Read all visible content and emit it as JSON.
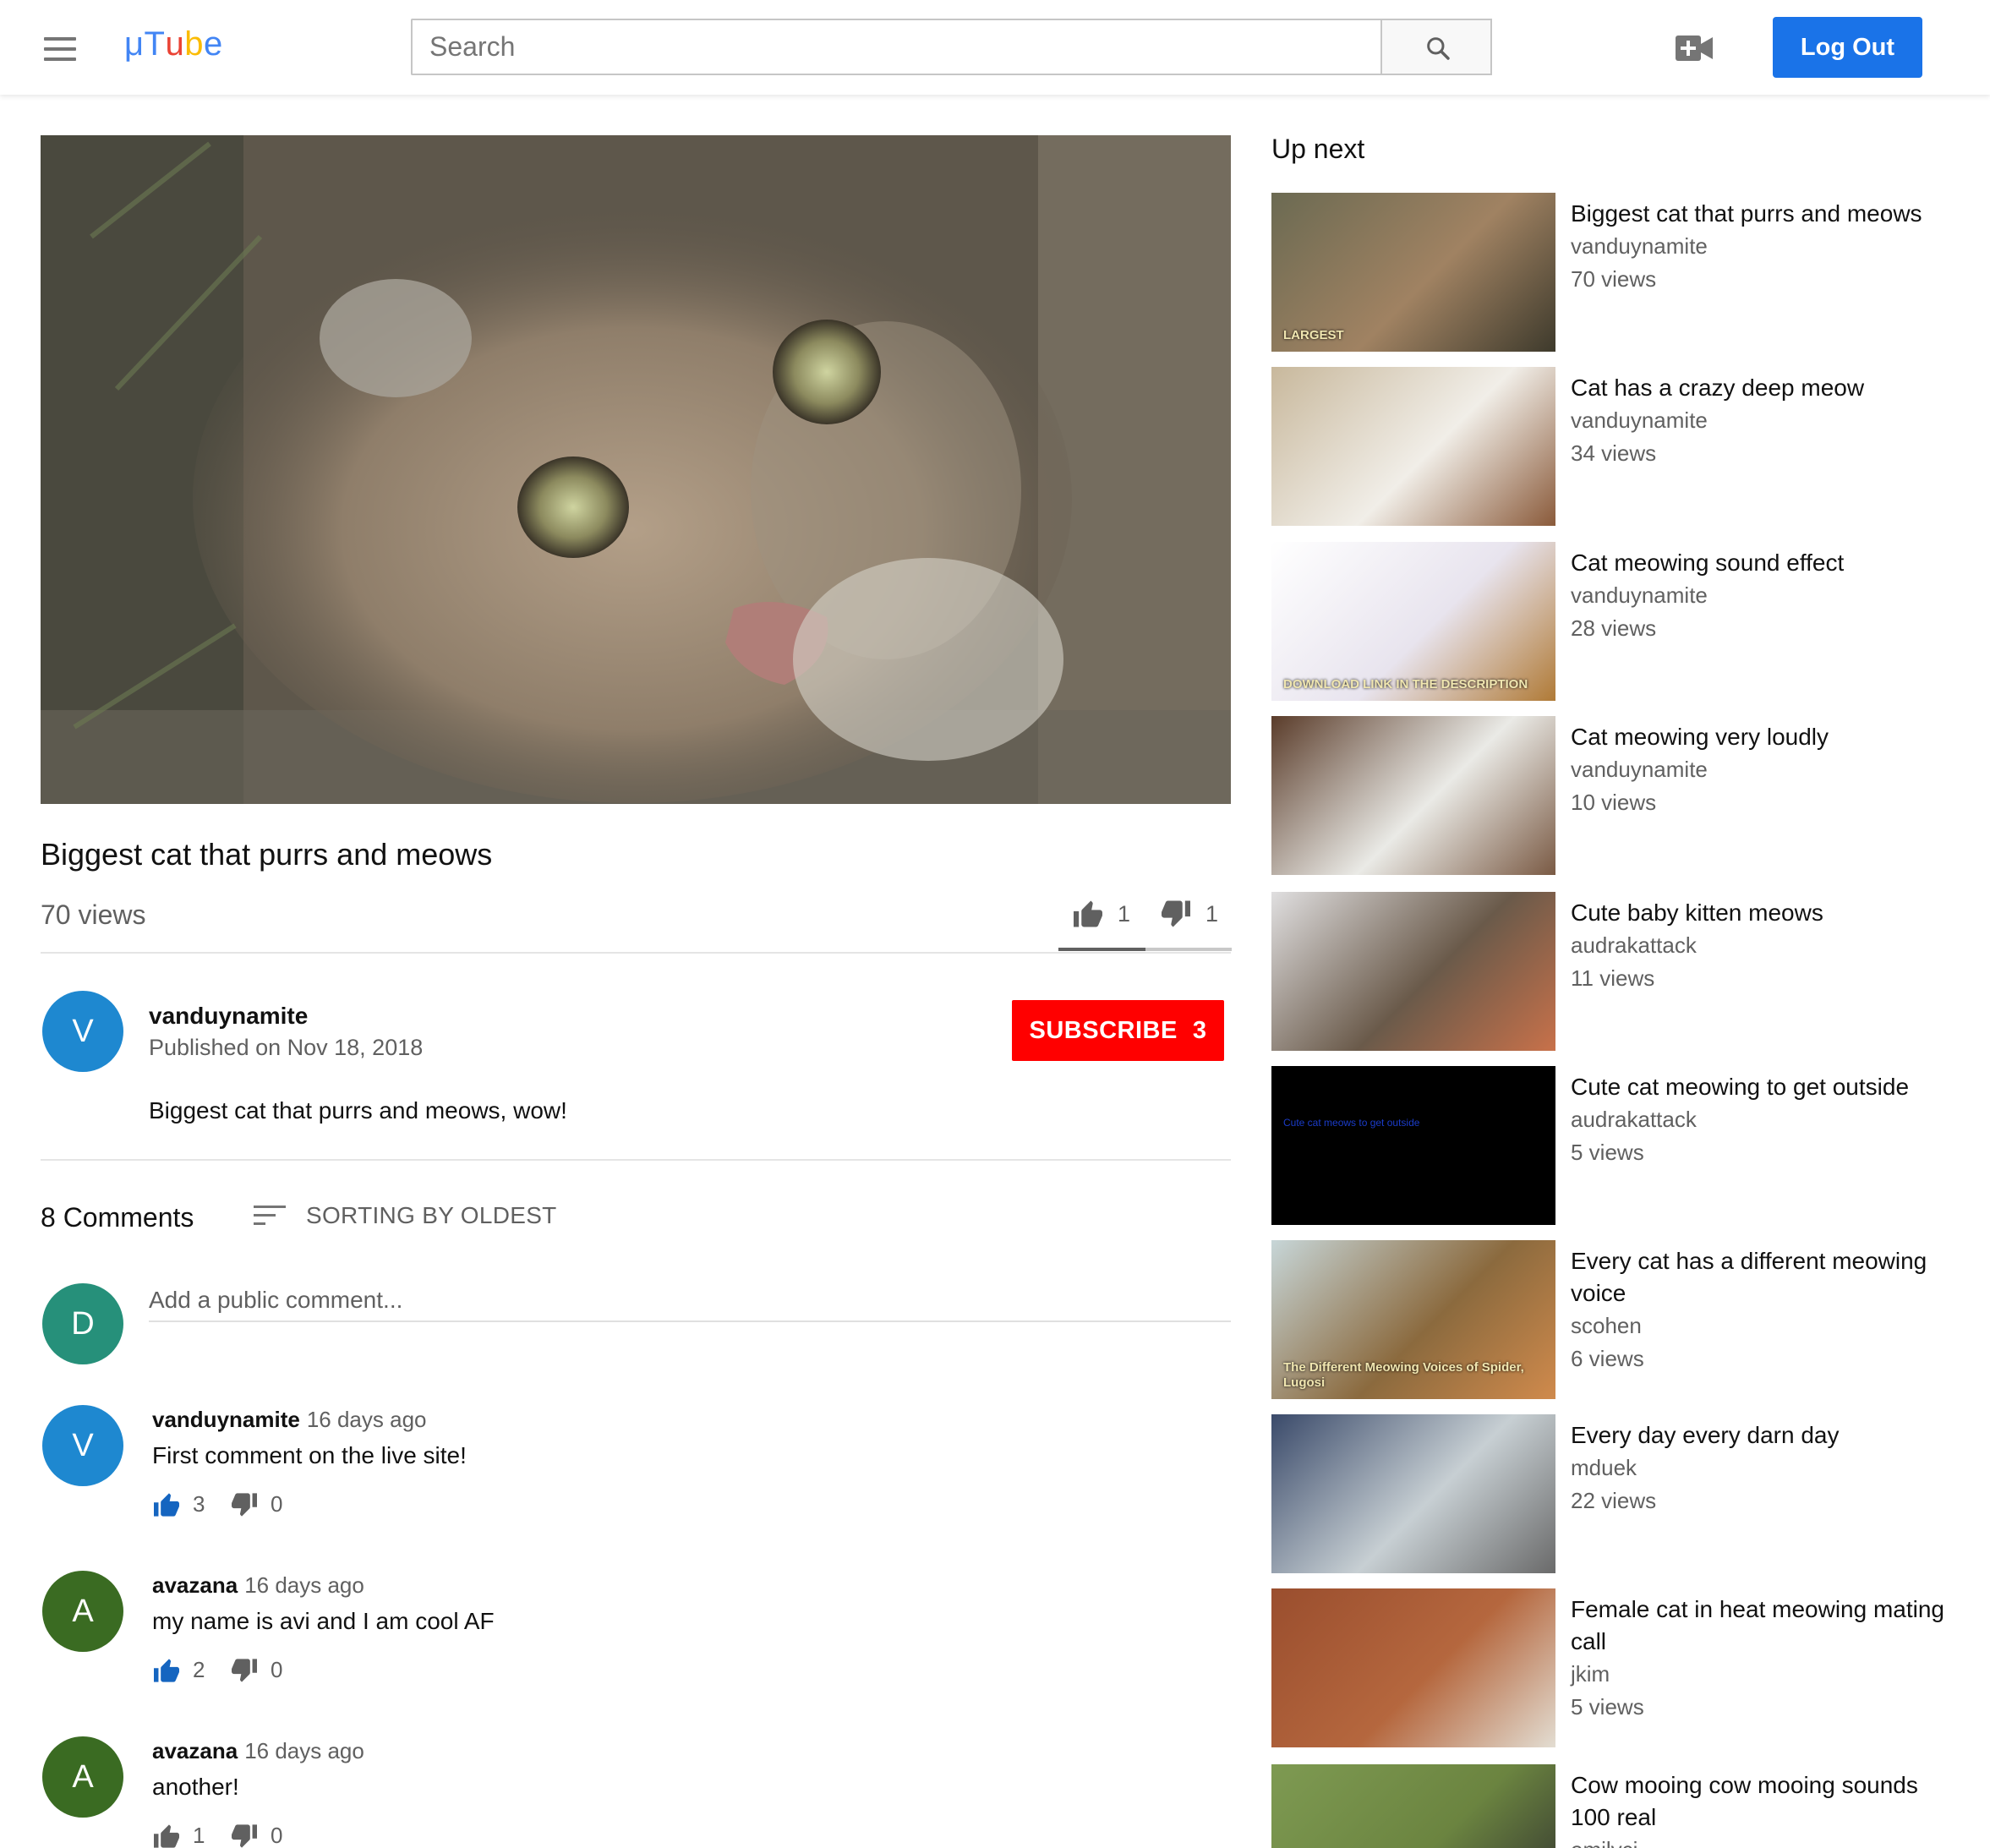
{
  "header": {
    "logo_letters": [
      "μ",
      "T",
      "u",
      "b",
      "e"
    ],
    "logo_colors": [
      "#4285F4",
      "#4285F4",
      "#EA4335",
      "#FBBC05",
      "#4285F4"
    ],
    "search_placeholder": "Search",
    "logout_label": "Log Out",
    "menu_icon": "hamburger-menu-icon",
    "search_icon": "search-icon",
    "upload_icon": "video-upload-icon"
  },
  "video": {
    "title": "Biggest cat that purrs and meows",
    "views": "70 views",
    "likes": "1",
    "dislikes": "1",
    "like_ratio": 0.5
  },
  "owner": {
    "avatar_letter": "V",
    "avatar_color": "#1e88d0",
    "name": "vanduynamite",
    "published": "Published on Nov 18, 2018",
    "subscribe_label": "SUBSCRIBE",
    "subscriber_count": "3"
  },
  "description": "Biggest cat that purrs and meows, wow!",
  "comments": {
    "count_label": "8 Comments",
    "sort_label": "SORTING BY OLDEST",
    "input_placeholder": "Add a public comment...",
    "current_user": {
      "avatar_letter": "D",
      "avatar_color": "#26907a"
    },
    "items": [
      {
        "author": "vanduynamite",
        "time": "16 days ago",
        "text": "First comment on the live site!",
        "likes": "3",
        "dislikes": "0",
        "avatar_letter": "V",
        "avatar_color": "#1e88d0",
        "liked": true
      },
      {
        "author": "avazana",
        "time": "16 days ago",
        "text": "my name is avi and I am cool AF",
        "likes": "2",
        "dislikes": "0",
        "avatar_letter": "A",
        "avatar_color": "#3a6b22",
        "liked": true
      },
      {
        "author": "avazana",
        "time": "16 days ago",
        "text": "another!",
        "likes": "1",
        "dislikes": "0",
        "avatar_letter": "A",
        "avatar_color": "#3a6b22",
        "liked": false
      }
    ]
  },
  "sidebar": {
    "heading": "Up next",
    "items": [
      {
        "title": "Biggest cat that purrs and meows",
        "channel": "vanduynamite",
        "views": "70 views",
        "thumb_colors": [
          "#6b6a52",
          "#a08262",
          "#3e3a2c"
        ],
        "thumb_text": "LARGEST"
      },
      {
        "title": "Cat has a crazy deep meow",
        "channel": "vanduynamite",
        "views": "34 views",
        "thumb_colors": [
          "#c8b89c",
          "#f1eee8",
          "#8a5a3a"
        ],
        "thumb_text": ""
      },
      {
        "title": "Cat meowing sound effect",
        "channel": "vanduynamite",
        "views": "28 views",
        "thumb_colors": [
          "#ffffff",
          "#e8e4ee",
          "#b07a36"
        ],
        "thumb_text": "DOWNLOAD LINK IN THE DESCRIPTION"
      },
      {
        "title": "Cat meowing very loudly",
        "channel": "vanduynamite",
        "views": "10 views",
        "thumb_colors": [
          "#5a3c2a",
          "#eaeae6",
          "#7a5a44"
        ],
        "thumb_text": ""
      },
      {
        "title": "Cute baby kitten meows",
        "channel": "audrakattack",
        "views": "11 views",
        "thumb_colors": [
          "#e0dfe0",
          "#6a5a4a",
          "#c8714a"
        ],
        "thumb_text": ""
      },
      {
        "title": "Cute cat meowing to get outside",
        "channel": "audrakattack",
        "views": "5 views",
        "thumb_colors": [
          "#000000",
          "#000000",
          "#000000"
        ],
        "thumb_text": "Cute cat meows to get outside"
      },
      {
        "title": "Every cat has a different meowing voice",
        "channel": "scohen",
        "views": "6 views",
        "thumb_colors": [
          "#c7d6d8",
          "#8b6a3e",
          "#d08a4c"
        ],
        "thumb_text": "The Different Meowing Voices of Spider, Lugosi"
      },
      {
        "title": "Every day every darn day",
        "channel": "mduek",
        "views": "22 views",
        "thumb_colors": [
          "#3a4a6a",
          "#c7cfd3",
          "#6a6a6a"
        ],
        "thumb_text": ""
      },
      {
        "title": "Female cat in heat meowing mating call",
        "channel": "jkim",
        "views": "5 views",
        "thumb_colors": [
          "#9a4e2e",
          "#b5673e",
          "#e3ddd2"
        ],
        "thumb_text": ""
      },
      {
        "title": "Cow mooing cow mooing sounds 100 real",
        "channel": "emilyci",
        "views": "",
        "thumb_colors": [
          "#7e9a52",
          "#6b8440",
          "#2e2e2e"
        ],
        "thumb_text": ""
      }
    ]
  }
}
